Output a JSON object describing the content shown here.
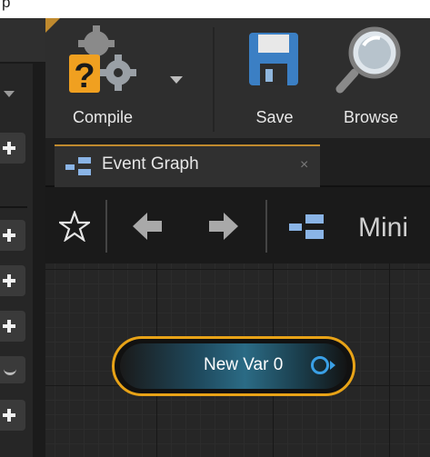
{
  "window": {
    "title_fragment": "p"
  },
  "toolbar": {
    "compile_label": "Compile",
    "save_label": "Save",
    "browse_label": "Browse"
  },
  "tabs": [
    {
      "label": "Event Graph",
      "close": "×"
    }
  ],
  "graph_toolbar": {
    "minimap_label": "Mini"
  },
  "node": {
    "label": "New Var 0"
  },
  "colors": {
    "accent": "#c08a2e",
    "node_border": "#e8a317",
    "pin": "#3aa0e6"
  }
}
